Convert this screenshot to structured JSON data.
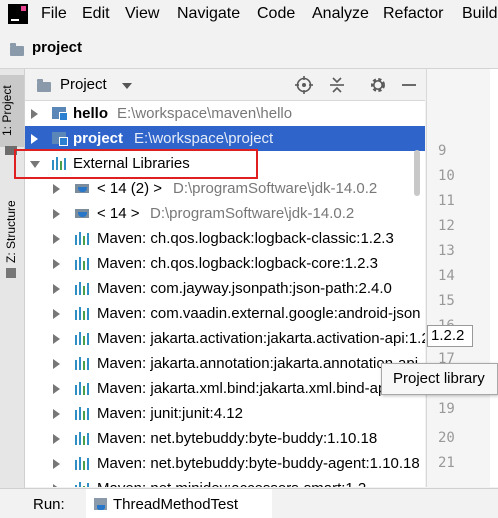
{
  "menu": [
    "File",
    "Edit",
    "View",
    "Navigate",
    "Code",
    "Analyze",
    "Refactor",
    "Build"
  ],
  "breadcrumb": "project",
  "left_tabs": {
    "project": "1: Project",
    "structure": "Z: Structure"
  },
  "panel": {
    "title": "Project"
  },
  "tree": {
    "hello": {
      "name": "hello",
      "path": "E:\\workspace\\maven\\hello"
    },
    "project": {
      "name": "project",
      "path": "E:\\workspace\\project"
    },
    "external_libraries": "External Libraries",
    "jdk1": {
      "name": "< 14 (2) >",
      "path": "D:\\programSoftware\\jdk-14.0.2"
    },
    "jdk2": {
      "name": "< 14 >",
      "path": "D:\\programSoftware\\jdk-14.0.2"
    },
    "libs": [
      "Maven: ch.qos.logback:logback-classic:1.2.3",
      "Maven: ch.qos.logback:logback-core:1.2.3",
      "Maven: com.jayway.jsonpath:json-path:2.4.0",
      "Maven: com.vaadin.external.google:android-json",
      "Maven: jakarta.activation:jakarta.activation-api:1.2.2",
      "Maven: jakarta.annotation:jakarta.annotation-api",
      "Maven: jakarta.xml.bind:jakarta.xml.bind-api",
      "Maven: junit:junit:4.12",
      "Maven: net.bytebuddy:byte-buddy:1.10.18",
      "Maven: net.bytebuddy:byte-buddy-agent:1.10.18",
      "Maven: net.minidev:accessors-smart:1.2"
    ]
  },
  "line_numbers": [
    "9",
    "10",
    "11",
    "12",
    "13",
    "14",
    "15",
    "16",
    "17",
    "18",
    "19",
    "20",
    "21"
  ],
  "tooltip": "Project library",
  "overlap_fragment": "1.2.2",
  "bottom": {
    "run_label": "Run:",
    "tab": "ThreadMethodTest"
  },
  "colors": {
    "selection": "#2f65ca",
    "highlight_box": "#e02020"
  }
}
